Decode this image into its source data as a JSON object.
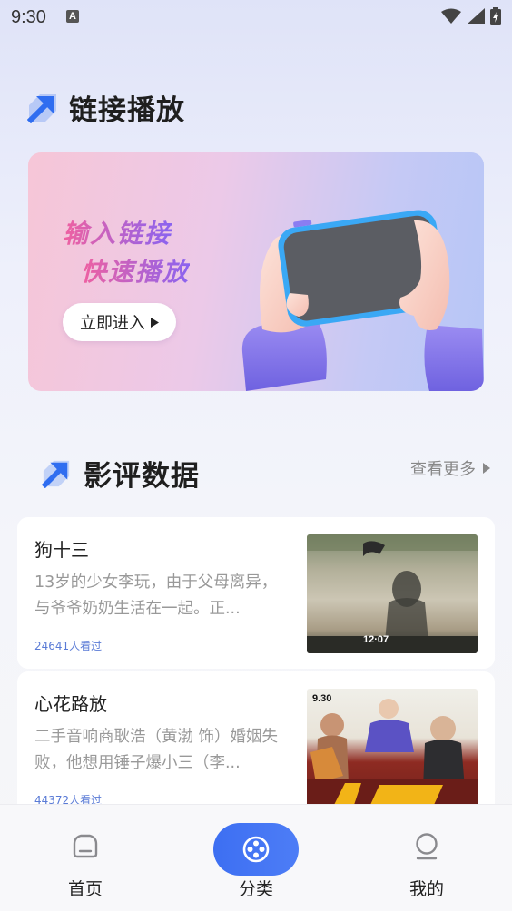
{
  "status_bar": {
    "time": "9:30",
    "notif_letter": "A"
  },
  "link_section": {
    "title": "链接播放"
  },
  "banner": {
    "line1": "输入链接",
    "line2": "快速播放",
    "button_label": "立即进入"
  },
  "review_section": {
    "title": "影评数据",
    "more_label": "查看更多"
  },
  "cards": [
    {
      "title": "狗十三",
      "desc": "13岁的少女李玩，由于父母离异，与爷爷奶奶生活在一起。正...",
      "views": "24641人看过",
      "poster_date": "12·07"
    },
    {
      "title": "心花路放",
      "desc": "二手音响商耿浩（黄渤 饰）婚姻失败，他想用锤子爆小三（李...",
      "views": "44372人看过",
      "poster_date": "9.30"
    }
  ],
  "tabs": [
    {
      "label": "首页",
      "icon": "home-icon"
    },
    {
      "label": "分类",
      "icon": "film-reel-icon",
      "active": true
    },
    {
      "label": "我的",
      "icon": "profile-icon"
    }
  ],
  "colors": {
    "accent": "#3d6ff2",
    "views": "#5a7bd6"
  }
}
